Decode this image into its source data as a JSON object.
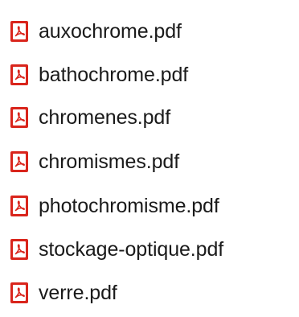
{
  "colors": {
    "icon_red": "#d9251c",
    "icon_white": "#ffffff",
    "text": "#1a1a1a"
  },
  "icon_name": "pdf-file-icon",
  "files": [
    {
      "name": "auxochrome.pdf"
    },
    {
      "name": "bathochrome.pdf"
    },
    {
      "name": "chromenes.pdf"
    },
    {
      "name": "chromismes.pdf"
    },
    {
      "name": "photochromisme.pdf"
    },
    {
      "name": "stockage-optique.pdf"
    },
    {
      "name": "verre.pdf"
    }
  ]
}
